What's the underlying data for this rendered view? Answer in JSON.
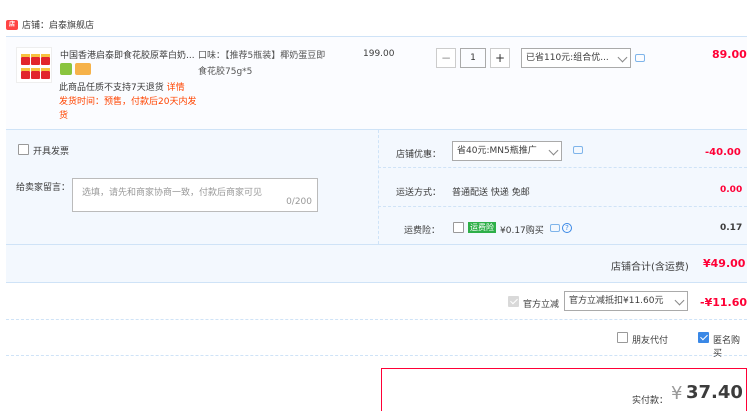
{
  "shop": {
    "label": "店铺：启泰旗舰店"
  },
  "item": {
    "title": "中国香港启泰即食花胶原萃白奶...",
    "notice_line1": "此商品任质不支持7天退货",
    "notice_link": "详情",
    "ship_label": "发货时间：",
    "ship_value": "预售，付款后20天内发货",
    "spec_line1": "口味：【推荐5瓶装】椰奶蛋豆即",
    "spec_line2": "食花胶75g*5",
    "unit_price": "199.00",
    "quantity": "1",
    "minus": "−",
    "plus": "+",
    "promo_select": "已省110元:组合优...",
    "total": "89.00"
  },
  "invoice": {
    "label": "开具发票"
  },
  "message": {
    "label": "给卖家留言：",
    "placeholder": "选填，请先和商家协商一致，付款后商家可见",
    "counter": "0/200"
  },
  "shop_discount": {
    "label": "店铺优惠：",
    "select": "省40元:MN5瓶推广",
    "value": "-40.00"
  },
  "shipping": {
    "label": "运送方式：",
    "method": "普通配送 快递 免邮",
    "value": "0.00"
  },
  "insurance": {
    "label": "运费险：",
    "tag": "运费险",
    "price": "¥0.17购买",
    "value": "0.17"
  },
  "subtotal": {
    "label": "店铺合计(含运费)",
    "value": "¥49.00"
  },
  "official": {
    "label": "官方立减",
    "select": "官方立减抵扣¥11.60元",
    "value": "-¥11.60"
  },
  "pay_options": {
    "friend_pay": "朋友代付",
    "anonymous": "匿名购买"
  },
  "actual": {
    "label": "实付款：",
    "currency": "¥",
    "value": "37.40"
  },
  "colors": {
    "accent_red": "#ff0036",
    "link_orange": "#ff4400",
    "blue": "#3a88e6"
  }
}
